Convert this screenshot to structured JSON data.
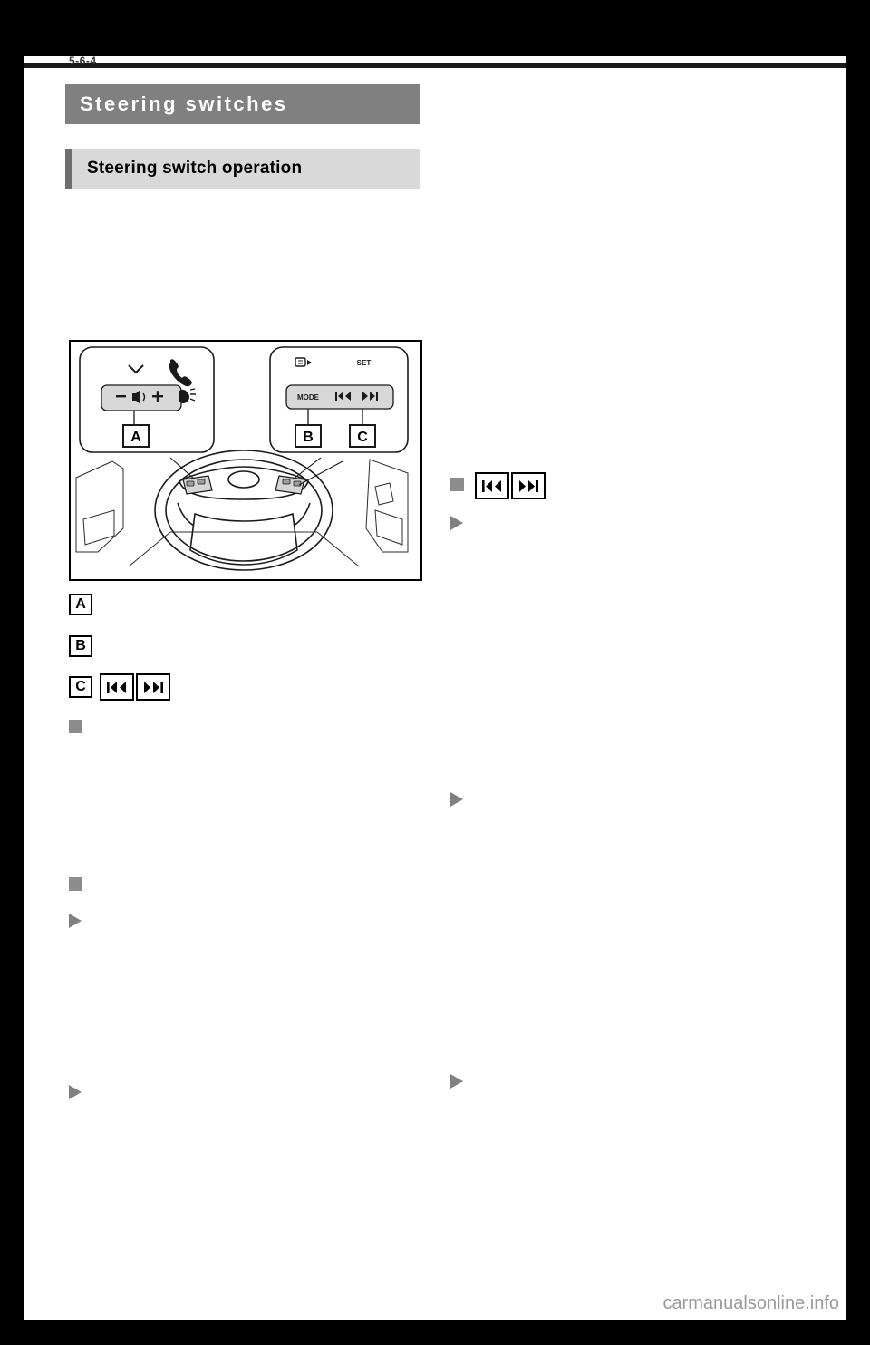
{
  "page": {
    "number": "5-6-4",
    "watermark": "carmanualsonline.info"
  },
  "section": {
    "title": "Steering switches"
  },
  "subsection": {
    "title": "Steering switch operation"
  },
  "illustration": {
    "name": "steering-wheel-switches-diagram",
    "left_switch_labels": {
      "volume_minus": "−",
      "volume_icon": "speaker",
      "volume_plus": "+",
      "phone_icon": "phone",
      "voice_icon": "voice-command",
      "chevron_icon": "chevron-down"
    },
    "right_switch_labels": {
      "mode": "MODE",
      "set": "− SET",
      "display_icon": "display-change",
      "prev_icon": "seek-down",
      "next_icon": "seek-up"
    },
    "callouts": [
      "A",
      "B",
      "C"
    ]
  },
  "legend": [
    {
      "marker": "A",
      "glyphs": []
    },
    {
      "marker": "B",
      "glyphs": []
    },
    {
      "marker": "C",
      "glyphs": [
        "seek-down-icon",
        "seek-up-icon"
      ]
    }
  ],
  "left_column": {
    "bullets": [
      {
        "type": "square",
        "label": ""
      },
      {
        "type": "square",
        "label": ""
      },
      {
        "type": "triangle",
        "label": ""
      },
      {
        "type": "triangle",
        "label": ""
      }
    ]
  },
  "right_column": {
    "bullets": [
      {
        "type": "square",
        "label": "",
        "glyphs": [
          "seek-down-icon",
          "seek-up-icon"
        ]
      },
      {
        "type": "triangle",
        "label": ""
      },
      {
        "type": "triangle",
        "label": ""
      },
      {
        "type": "triangle",
        "label": ""
      }
    ]
  }
}
